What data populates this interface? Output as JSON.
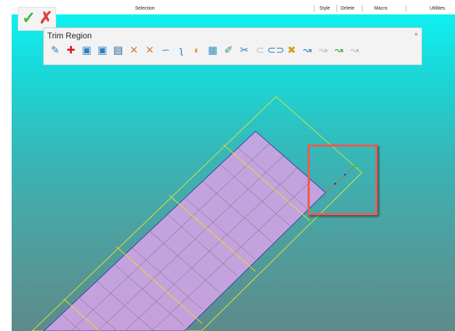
{
  "topbar": {
    "selection": "Selection",
    "style": "Style",
    "delete": "Delete",
    "macro": "Macro",
    "utilities": "Utilities"
  },
  "accept": {
    "ok_icon": "✓",
    "cancel_icon": "✗"
  },
  "toolbar": {
    "title": "Trim Region",
    "close": "×",
    "icons": [
      {
        "name": "trim-select-icon",
        "glyph": "✎",
        "color": "#3a7fc0"
      },
      {
        "name": "add-icon",
        "glyph": "✚",
        "color": "#e02020"
      },
      {
        "name": "region-select-icon",
        "glyph": "▣",
        "color": "#2a80c0"
      },
      {
        "name": "region-select2-icon",
        "glyph": "▣",
        "color": "#2a80c0"
      },
      {
        "name": "multi-region-icon",
        "glyph": "▤",
        "color": "#2a60a0"
      },
      {
        "name": "delete-curve-icon",
        "glyph": "✕",
        "color": "#d08040"
      },
      {
        "name": "delete-loop-icon",
        "glyph": "✕",
        "color": "#d08040"
      },
      {
        "name": "curve-icon",
        "glyph": "∽",
        "color": "#2aa0d0"
      },
      {
        "name": "spline-icon",
        "glyph": "ʅ",
        "color": "#2a80c0"
      },
      {
        "name": "surface-icon",
        "glyph": "◐",
        "color": "#d0a020"
      },
      {
        "name": "export-icon",
        "glyph": "▦",
        "color": "#3a90c0"
      },
      {
        "name": "pen-icon",
        "glyph": "✐",
        "color": "#2aa060"
      },
      {
        "name": "scissors-icon",
        "glyph": "✂",
        "color": "#2a80c0"
      },
      {
        "name": "arc-disabled-icon",
        "glyph": "⊂",
        "color": "#bbbbbb"
      },
      {
        "name": "loop-icon",
        "glyph": "⊂⊃",
        "color": "#2a80c0"
      },
      {
        "name": "erase-icon",
        "glyph": "✖",
        "color": "#d0a020"
      },
      {
        "name": "cursor-curve-icon",
        "glyph": "↝",
        "color": "#2a80c0"
      },
      {
        "name": "disabled-curve-icon",
        "glyph": "↝",
        "color": "#bbbbbb"
      },
      {
        "name": "green-curve-icon",
        "glyph": "↝",
        "color": "#2aa040"
      },
      {
        "name": "disabled-curve2-icon",
        "glyph": "↝",
        "color": "#bbbbbb"
      }
    ]
  }
}
